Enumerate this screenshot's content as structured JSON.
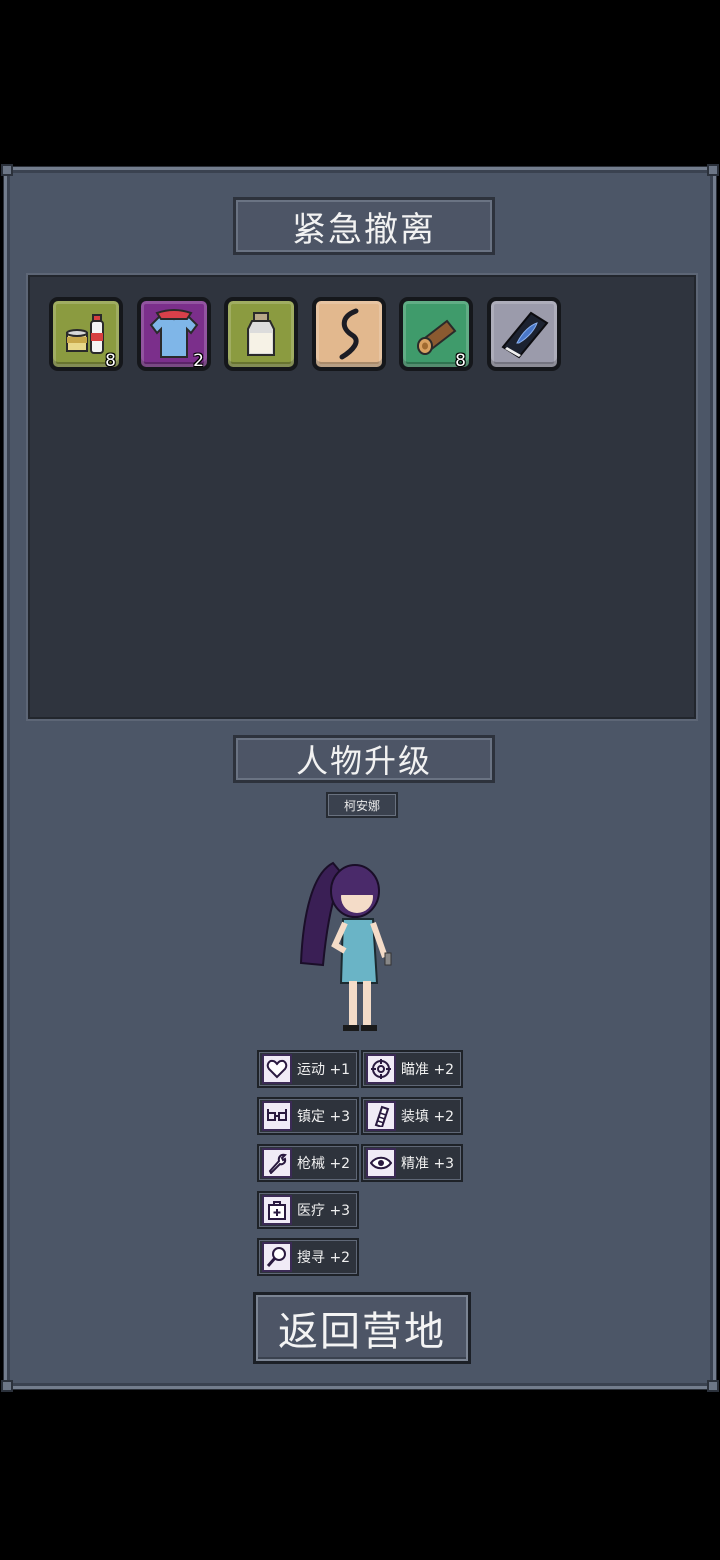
{
  "evacuation": {
    "title": "紧急撤离",
    "items": [
      {
        "icon": "canned-food-and-bottle-icon",
        "count": "8",
        "color": "#8a9a3f"
      },
      {
        "icon": "blue-shirt-icon",
        "count": "2",
        "color": "#7a2f8a"
      },
      {
        "icon": "milk-bottle-icon",
        "count": "",
        "color": "#8a9a3f"
      },
      {
        "icon": "rope-icon",
        "count": "",
        "color": "#e0b68c"
      },
      {
        "icon": "wood-log-icon",
        "count": "8",
        "color": "#3f9a6a"
      },
      {
        "icon": "fish-book-icon",
        "count": "",
        "color": "#9a9aaa"
      }
    ]
  },
  "upgrade": {
    "title": "人物升级",
    "character_name": "柯安娜",
    "stats": [
      {
        "icon": "heart-icon",
        "label": "运动 +1"
      },
      {
        "icon": "crosshair-icon",
        "label": "瞄准 +2"
      },
      {
        "icon": "glasses-icon",
        "label": "镇定 +3"
      },
      {
        "icon": "ammo-clip-icon",
        "label": "装填 +2"
      },
      {
        "icon": "wrench-icon",
        "label": "枪械 +2"
      },
      {
        "icon": "eye-icon",
        "label": "精准 +3"
      },
      {
        "icon": "medkit-icon",
        "label": "医疗 +3"
      },
      {
        "icon": "magnifier-icon",
        "label": "搜寻 +2"
      }
    ]
  },
  "return_button": "返回营地"
}
